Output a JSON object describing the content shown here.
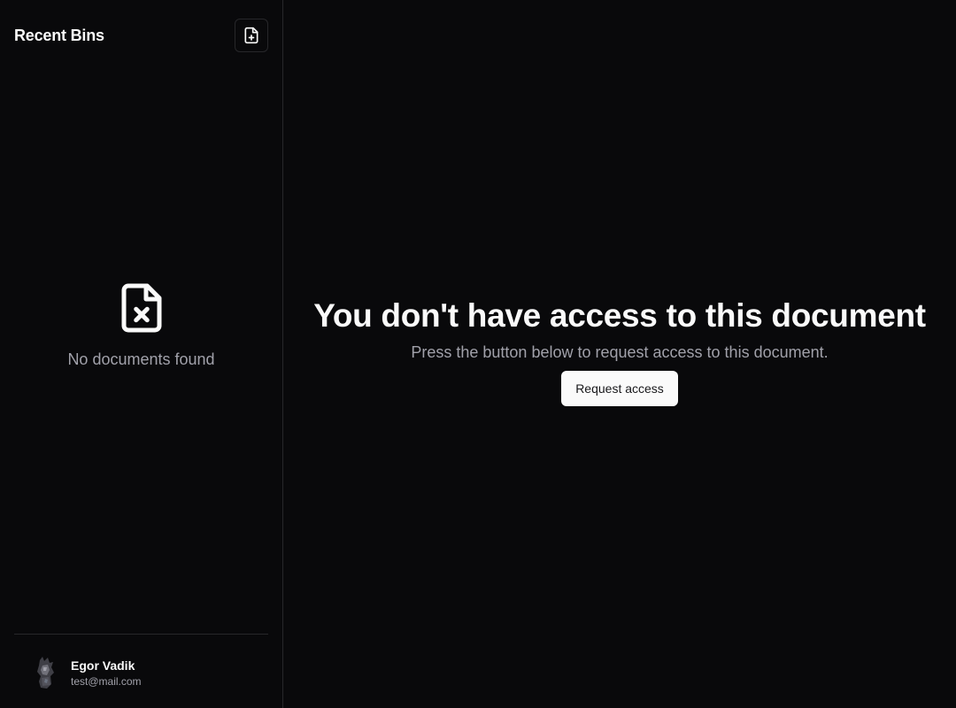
{
  "sidebar": {
    "title": "Recent Bins",
    "new_bin_icon": "file-plus-icon",
    "empty_icon": "file-x-icon",
    "empty_text": "No documents found",
    "user": {
      "name": "Egor Vadik",
      "email": "test@mail.com"
    }
  },
  "main": {
    "title": "You don't have access to this document",
    "subtitle": "Press the button below to request access to this document.",
    "request_button_label": "Request access"
  },
  "colors": {
    "background": "#09090b",
    "border": "#27272a",
    "text": "#fafafa",
    "muted_text": "#a1a1aa",
    "button_bg": "#fafafa",
    "button_text": "#18181b"
  }
}
